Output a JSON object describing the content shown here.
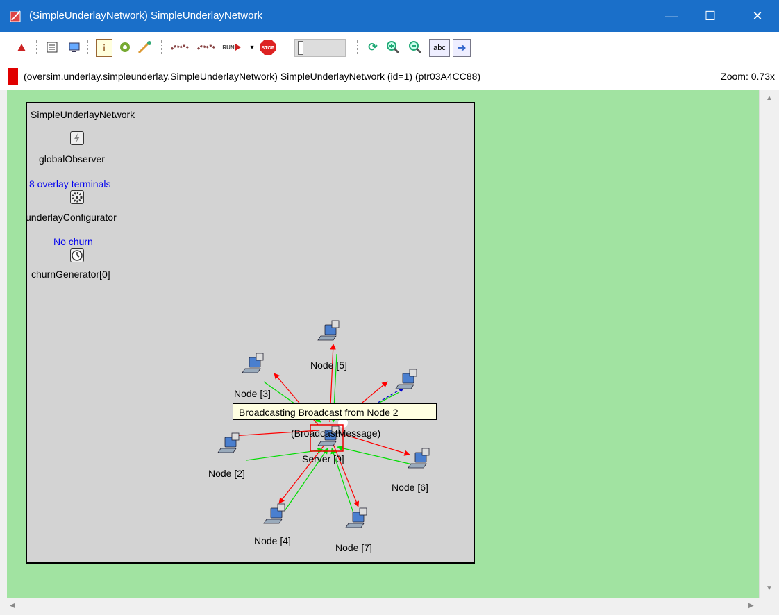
{
  "window": {
    "title": "(SimpleUnderlayNetwork) SimpleUnderlayNetwork",
    "minimize": "—",
    "maximize": "☐",
    "close": "✕"
  },
  "infobar": {
    "path": "(oversim.underlay.simpleunderlay.SimpleUnderlayNetwork) SimpleUnderlayNetwork  (id=1)  (ptr03A4CC88)",
    "zoom": "Zoom: 0.73x"
  },
  "toolbar": {
    "run_label": "RUN",
    "stop_label": "STOP",
    "info_label": "i",
    "abc_label": "abc"
  },
  "network": {
    "name": "SimpleUnderlayNetwork",
    "global_observer": "globalObserver",
    "configurator_status": "8 overlay terminals",
    "configurator": "underlayConfigurator",
    "churn_status": "No churn",
    "churn_generator": "churnGenerator[0]",
    "server": "Server [0]",
    "message": "(BroadcastMessage)",
    "nodes": [
      "Node [2]",
      "Node [3]",
      "Node [4]",
      "Node [5]",
      "Node [6]",
      "Node [7]"
    ]
  },
  "tooltip": "Broadcasting Broadcast from Node 2",
  "colors": {
    "titlebar": "#1a6fc9",
    "canvas": "#a1e3a1",
    "network_bg": "#d3d3d3",
    "send_arrow": "#ff0000",
    "recv_arrow": "#00dd00",
    "message": "#0000cc"
  }
}
